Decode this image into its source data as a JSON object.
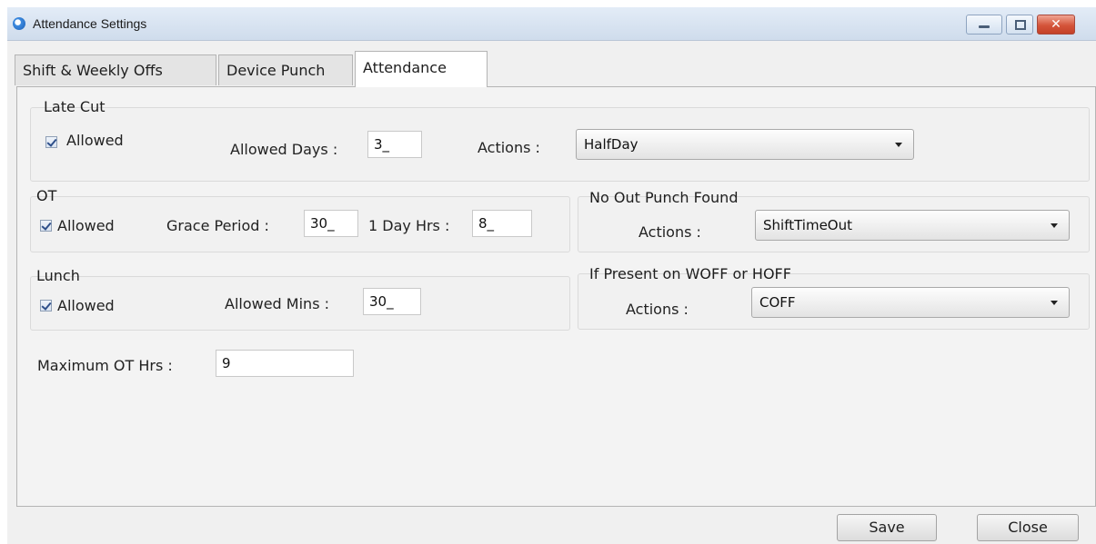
{
  "window": {
    "title": "Attendance Settings"
  },
  "tabs": [
    "Shift & Weekly Offs",
    "Device Punch",
    "Attendance"
  ],
  "late_cut": {
    "title": "Late Cut",
    "allowed_label": "Allowed",
    "allowed_checked": true,
    "days_label": "Allowed Days :",
    "days_value": "3_",
    "actions_label": "Actions :",
    "action_value": "HalfDay"
  },
  "ot": {
    "title": "OT",
    "allowed_label": "Allowed",
    "allowed_checked": true,
    "grace_label": "Grace Period :",
    "grace_value": "30_",
    "day_hrs_label": "1 Day Hrs :",
    "day_hrs_value": "8_"
  },
  "no_out_punch": {
    "title": "No Out Punch Found",
    "actions_label": "Actions :",
    "action_value": "ShiftTimeOut"
  },
  "lunch": {
    "title": "Lunch",
    "allowed_label": "Allowed",
    "allowed_checked": true,
    "mins_label": "Allowed Mins :",
    "mins_value": "30_"
  },
  "woff_hoff": {
    "title": "If Present on WOFF or HOFF",
    "actions_label": "Actions :",
    "action_value": "COFF"
  },
  "max_ot": {
    "label": "Maximum OT Hrs :",
    "value": "9"
  },
  "buttons": {
    "save": "Save",
    "close": "Close"
  },
  "icons": {
    "app": "app-icon",
    "minimize": "minimize-icon",
    "maximize": "maximize-icon",
    "close": "close-icon",
    "checkbox": "check-icon",
    "dropdown": "chevron-down-icon"
  }
}
